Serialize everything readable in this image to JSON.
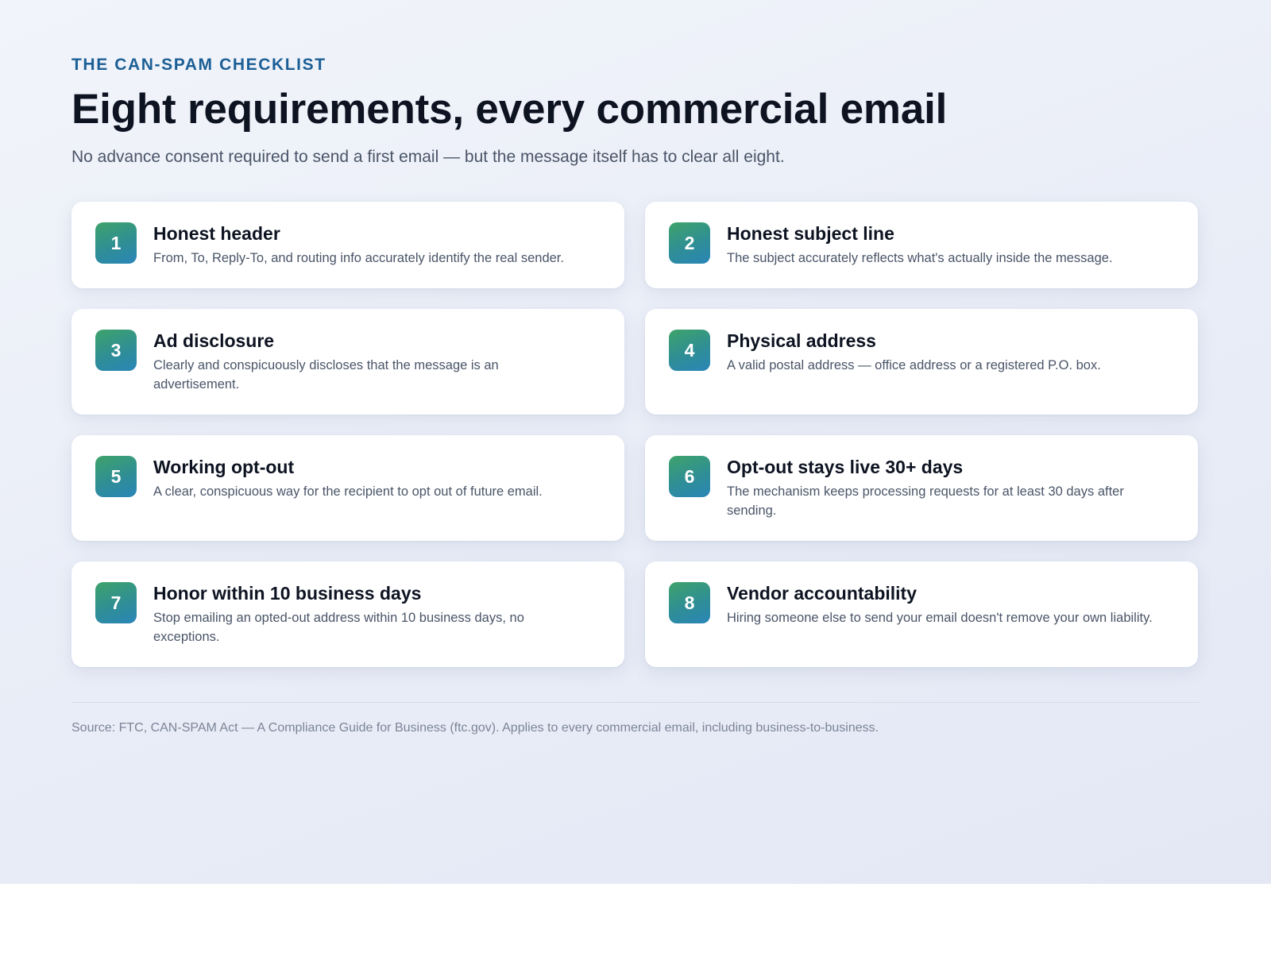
{
  "header": {
    "kicker": "THE CAN-SPAM CHECKLIST",
    "title": "Eight requirements, every commercial email",
    "subtitle": "No advance consent required to send a first email — but the message itself has to clear all eight."
  },
  "accent": {
    "kicker_color": "#1c5f96",
    "badge_gradient": [
      "#3ea36a",
      "#2a86b8"
    ]
  },
  "requirements": [
    {
      "number": "1",
      "title": "Honest header",
      "description": "From, To, Reply-To, and routing info accurately identify the real sender."
    },
    {
      "number": "2",
      "title": "Honest subject line",
      "description": "The subject accurately reflects what's actually inside the message."
    },
    {
      "number": "3",
      "title": "Ad disclosure",
      "description": "Clearly and conspicuously discloses that the message is an advertisement."
    },
    {
      "number": "4",
      "title": "Physical address",
      "description": "A valid postal address — office address or a registered P.O. box."
    },
    {
      "number": "5",
      "title": "Working opt-out",
      "description": "A clear, conspicuous way for the recipient to opt out of future email."
    },
    {
      "number": "6",
      "title": "Opt-out stays live 30+ days",
      "description": "The mechanism keeps processing requests for at least 30 days after sending."
    },
    {
      "number": "7",
      "title": "Honor within 10 business days",
      "description": "Stop emailing an opted-out address within 10 business days, no exceptions."
    },
    {
      "number": "8",
      "title": "Vendor accountability",
      "description": "Hiring someone else to send your email doesn't remove your own liability."
    }
  ],
  "footer": {
    "source": "Source: FTC, CAN-SPAM Act — A Compliance Guide for Business (ftc.gov). Applies to every commercial email, including business-to-business."
  }
}
